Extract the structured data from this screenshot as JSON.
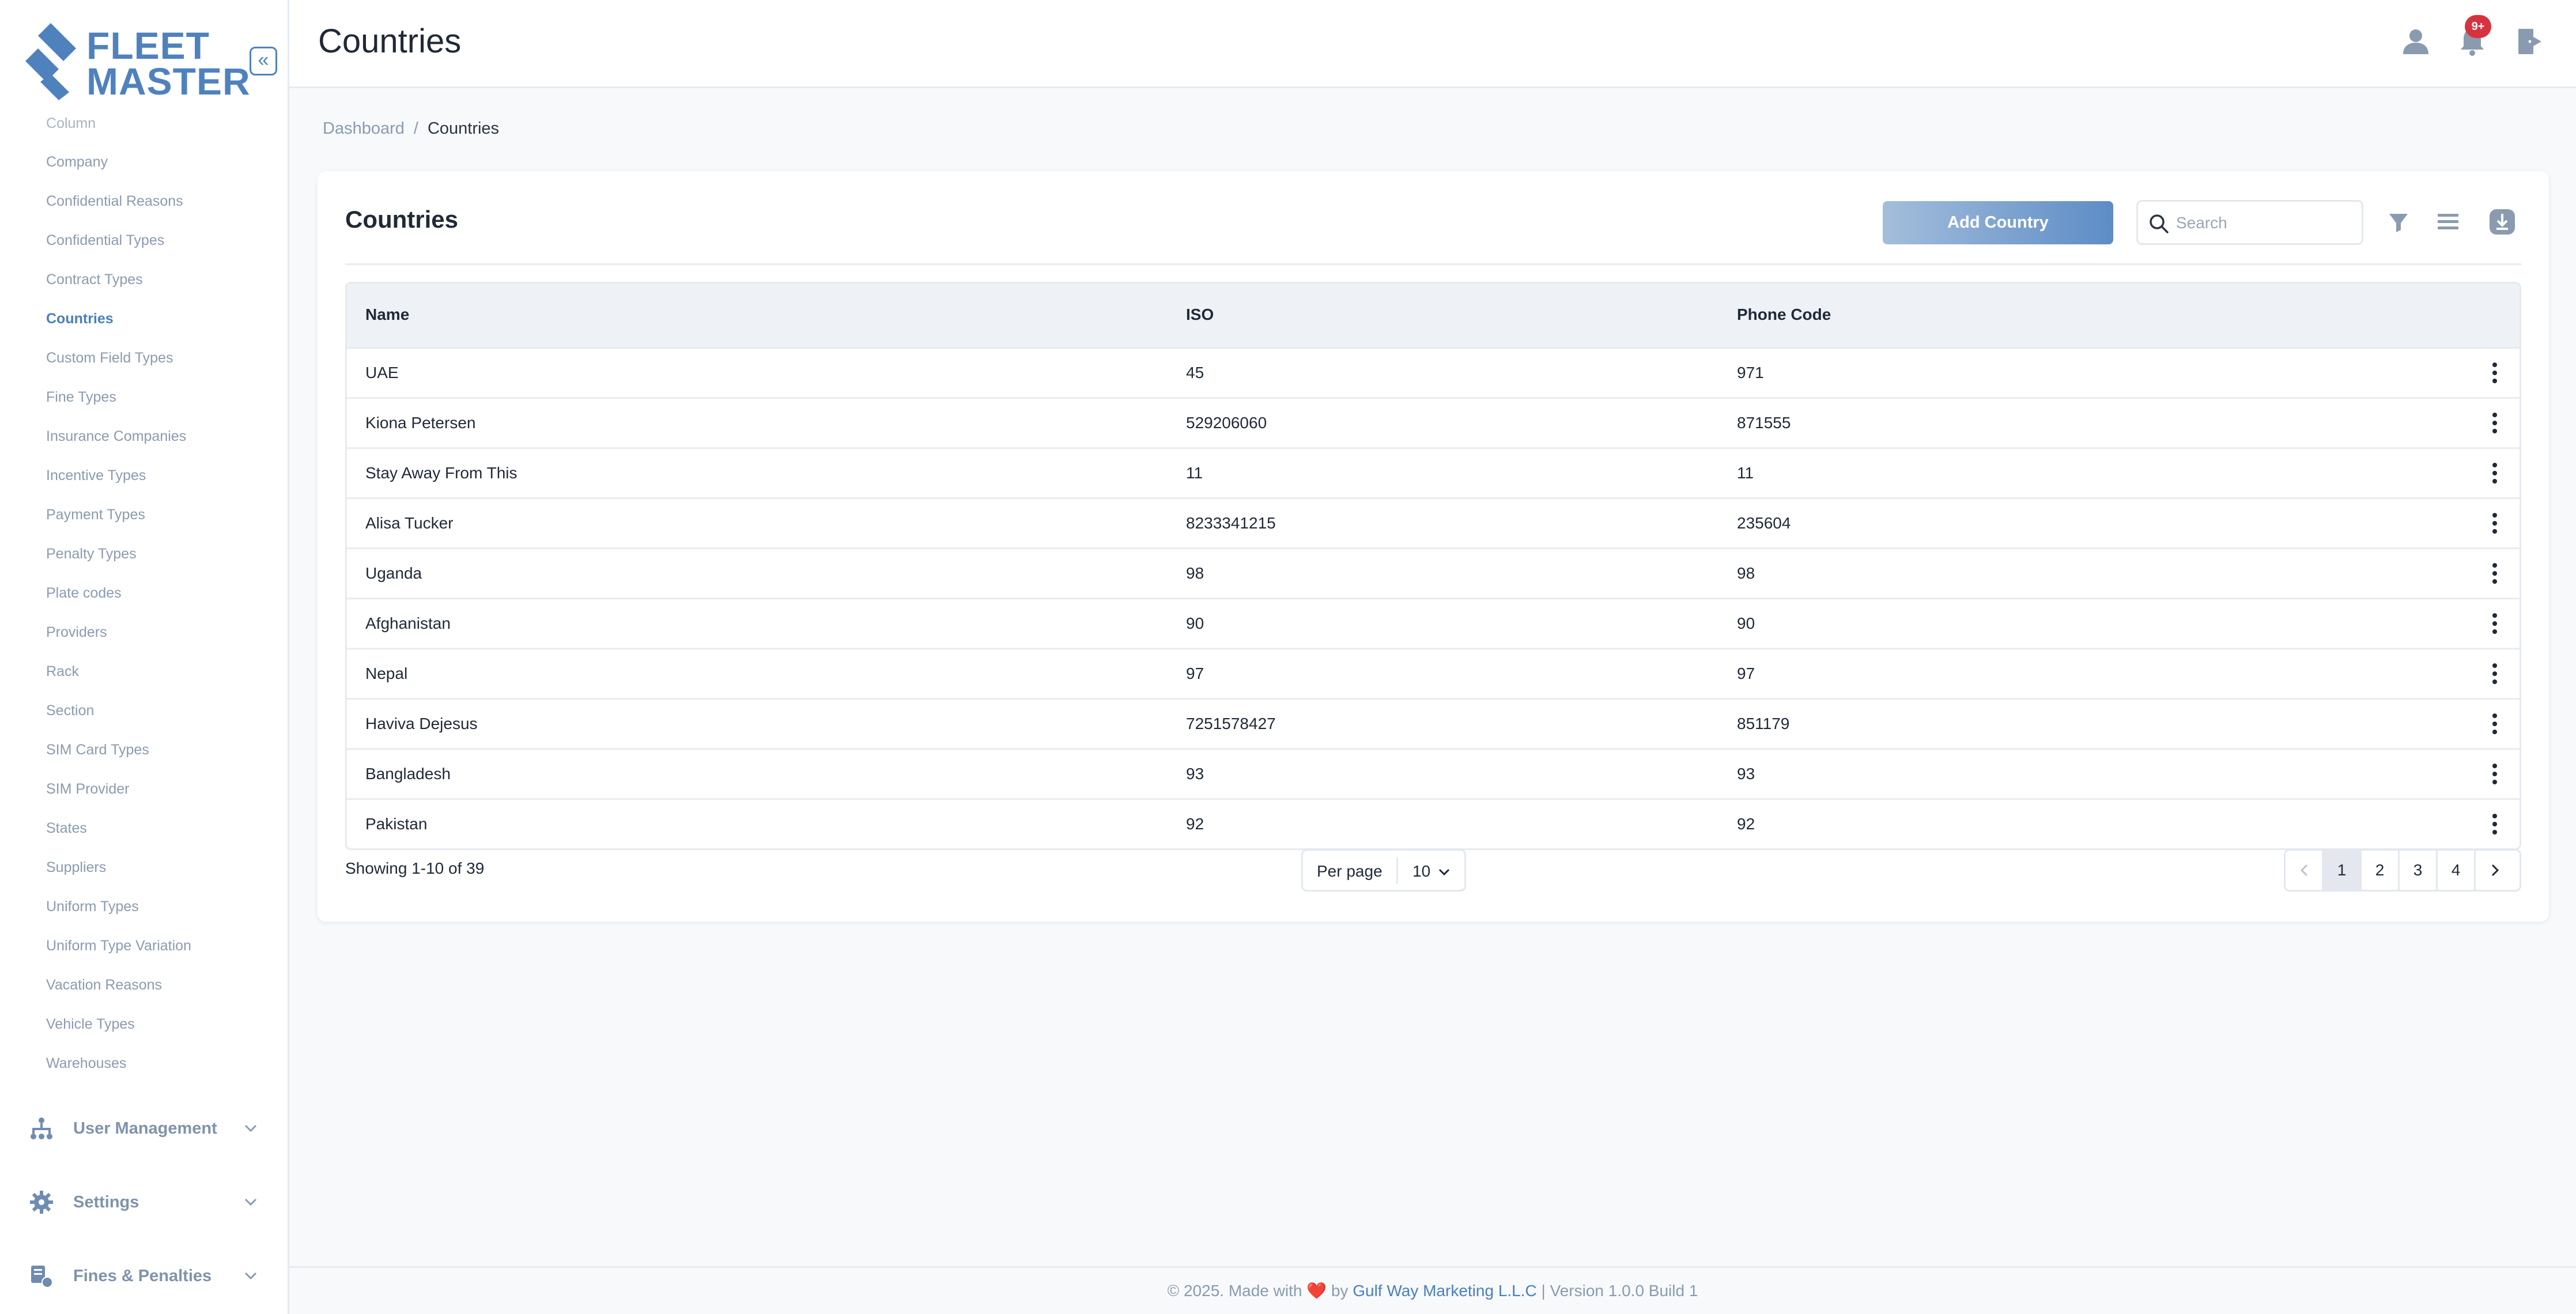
{
  "brand": {
    "line1": "FLEET",
    "line2": "MASTER"
  },
  "header": {
    "title": "Countries",
    "notification_count": "9+"
  },
  "breadcrumb": {
    "home": "Dashboard",
    "separator": "/",
    "current": "Countries"
  },
  "sidebar": {
    "items": [
      {
        "label": "Column"
      },
      {
        "label": "Company"
      },
      {
        "label": "Confidential Reasons"
      },
      {
        "label": "Confidential Types"
      },
      {
        "label": "Contract Types"
      },
      {
        "label": "Countries"
      },
      {
        "label": "Custom Field Types"
      },
      {
        "label": "Fine Types"
      },
      {
        "label": "Insurance Companies"
      },
      {
        "label": "Incentive Types"
      },
      {
        "label": "Payment Types"
      },
      {
        "label": "Penalty Types"
      },
      {
        "label": "Plate codes"
      },
      {
        "label": "Providers"
      },
      {
        "label": "Rack"
      },
      {
        "label": "Section"
      },
      {
        "label": "SIM Card Types"
      },
      {
        "label": "SIM Provider"
      },
      {
        "label": "States"
      },
      {
        "label": "Suppliers"
      },
      {
        "label": "Uniform Types"
      },
      {
        "label": "Uniform Type Variation"
      },
      {
        "label": "Vacation Reasons"
      },
      {
        "label": "Vehicle Types"
      },
      {
        "label": "Warehouses"
      }
    ],
    "active_item": "Countries",
    "groups": [
      {
        "label": "User Management",
        "icon": "sitemap-icon"
      },
      {
        "label": "Settings",
        "icon": "gear-icon"
      },
      {
        "label": "Fines & Penalties",
        "icon": "fines-icon"
      }
    ]
  },
  "card": {
    "title": "Countries",
    "add_button": "Add Country",
    "search_placeholder": "Search"
  },
  "table": {
    "columns": [
      "Name",
      "ISO",
      "Phone Code"
    ],
    "rows": [
      {
        "name": "UAE",
        "iso": "45",
        "phone": "971"
      },
      {
        "name": "Kiona Petersen",
        "iso": "529206060",
        "phone": "871555"
      },
      {
        "name": "Stay Away From This",
        "iso": "11",
        "phone": "11"
      },
      {
        "name": "Alisa Tucker",
        "iso": "8233341215",
        "phone": "235604"
      },
      {
        "name": "Uganda",
        "iso": "98",
        "phone": "98"
      },
      {
        "name": "Afghanistan",
        "iso": "90",
        "phone": "90"
      },
      {
        "name": "Nepal",
        "iso": "97",
        "phone": "97"
      },
      {
        "name": "Haviva Dejesus",
        "iso": "7251578427",
        "phone": "851179"
      },
      {
        "name": "Bangladesh",
        "iso": "93",
        "phone": "93"
      },
      {
        "name": "Pakistan",
        "iso": "92",
        "phone": "92"
      }
    ]
  },
  "pagination": {
    "showing": "Showing 1-10 of 39",
    "per_page_label": "Per page",
    "per_page_value": "10",
    "pages": [
      "1",
      "2",
      "3",
      "4"
    ],
    "current_page": "1"
  },
  "footer": {
    "prefix": "© 2025. Made with",
    "heart": "❤️",
    "by": "by",
    "company": "Gulf Way Marketing L.L.C",
    "version": "| Version 1.0.0 Build 1"
  },
  "colors": {
    "accent": "#4f82bd",
    "badge": "#d7333f",
    "background": "#f7f9fb"
  }
}
